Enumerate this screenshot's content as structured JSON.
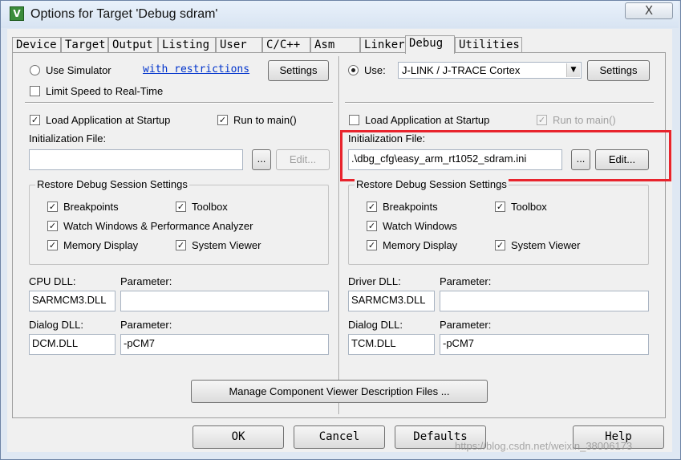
{
  "window": {
    "title": "Options for Target 'Debug sdram'",
    "close_glyph": "X",
    "app_icon_glyph": "V"
  },
  "tabs": [
    {
      "label": "Device"
    },
    {
      "label": "Target"
    },
    {
      "label": "Output"
    },
    {
      "label": "Listing"
    },
    {
      "label": "User"
    },
    {
      "label": "C/C++"
    },
    {
      "label": "Asm"
    },
    {
      "label": "Linker"
    },
    {
      "label": "Debug",
      "active": true
    },
    {
      "label": "Utilities"
    }
  ],
  "left": {
    "use_simulator": {
      "label": "Use Simulator",
      "selected": false
    },
    "restrictions_link": "with restrictions",
    "settings_button": "Settings",
    "limit_speed": {
      "label": "Limit Speed to Real-Time",
      "checked": false
    },
    "load_application": {
      "label": "Load Application at Startup",
      "checked": true
    },
    "run_to_main": {
      "label": "Run to main()",
      "checked": true
    },
    "init_file_label": "Initialization File:",
    "init_file_value": "",
    "browse_button": "...",
    "edit_button": "Edit...",
    "restore_group": {
      "title": "Restore Debug Session Settings",
      "breakpoints": {
        "label": "Breakpoints",
        "checked": true
      },
      "toolbox": {
        "label": "Toolbox",
        "checked": true
      },
      "watch_windows": {
        "label": "Watch Windows & Performance Analyzer",
        "checked": true
      },
      "memory_display": {
        "label": "Memory Display",
        "checked": true
      },
      "system_viewer": {
        "label": "System Viewer",
        "checked": true
      }
    },
    "cpu_dll_label": "CPU DLL:",
    "cpu_dll_value": "SARMCM3.DLL",
    "cpu_param_label": "Parameter:",
    "cpu_param_value": "",
    "dialog_dll_label": "Dialog DLL:",
    "dialog_dll_value": "DCM.DLL",
    "dialog_param_label": "Parameter:",
    "dialog_param_value": "-pCM7"
  },
  "right": {
    "use": {
      "label": "Use:",
      "selected": true
    },
    "driver_select": "J-LINK / J-TRACE Cortex",
    "settings_button": "Settings",
    "load_application": {
      "label": "Load Application at Startup",
      "checked": false
    },
    "run_to_main": {
      "label": "Run to main()",
      "checked": true,
      "disabled": true
    },
    "init_file_label": "Initialization File:",
    "init_file_value": ".\\dbg_cfg\\easy_arm_rt1052_sdram.ini",
    "browse_button": "...",
    "edit_button": "Edit...",
    "restore_group": {
      "title": "Restore Debug Session Settings",
      "breakpoints": {
        "label": "Breakpoints",
        "checked": true
      },
      "toolbox": {
        "label": "Toolbox",
        "checked": true
      },
      "watch_windows": {
        "label": "Watch Windows",
        "checked": true
      },
      "memory_display": {
        "label": "Memory Display",
        "checked": true
      },
      "system_viewer": {
        "label": "System Viewer",
        "checked": true
      }
    },
    "driver_dll_label": "Driver DLL:",
    "driver_dll_value": "SARMCM3.DLL",
    "driver_param_label": "Parameter:",
    "driver_param_value": "",
    "dialog_dll_label": "Dialog DLL:",
    "dialog_dll_value": "TCM.DLL",
    "dialog_param_label": "Parameter:",
    "dialog_param_value": "-pCM7"
  },
  "manage_button": "Manage Component Viewer Description Files ...",
  "footer": {
    "ok": "OK",
    "cancel": "Cancel",
    "defaults": "Defaults",
    "help": "Help"
  },
  "watermark": "https://blog.csdn.net/weixin_38006173",
  "colors": {
    "highlight_box": "#e8242d",
    "link": "#0033cc"
  },
  "check_glyph": "✓",
  "dropdown_glyph": "▼"
}
